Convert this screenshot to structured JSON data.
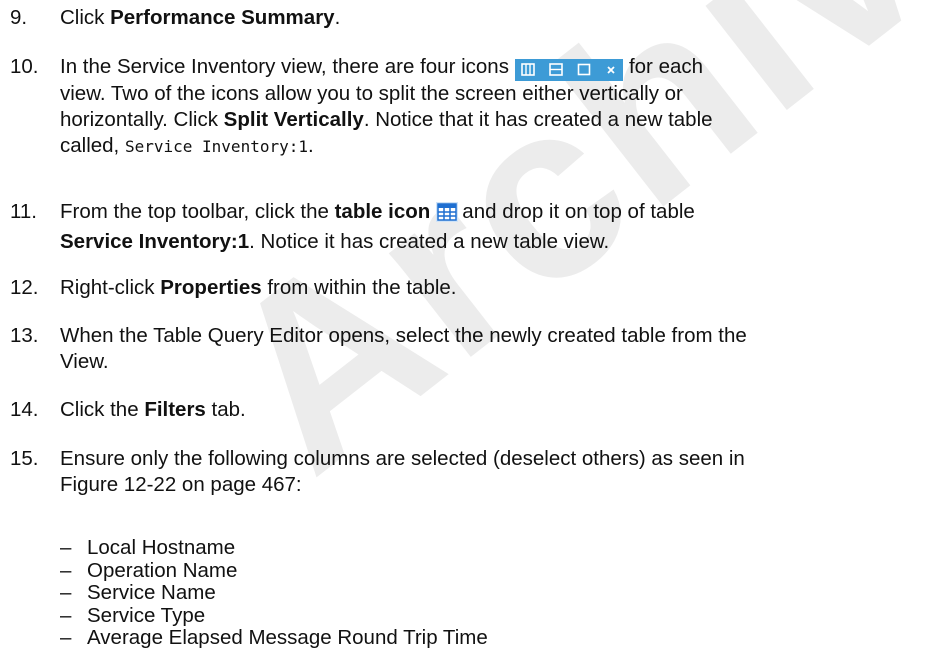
{
  "watermark": "Archived",
  "steps": [
    {
      "num": "9.",
      "parts": [
        "Click ",
        "Performance Summary",
        "."
      ]
    },
    {
      "num": "10.",
      "line1_a": "In the Service Inventory view, there are four icons",
      "line1_b": "for each",
      "line2": "view. Two of the icons allow you to split the screen either vertically or",
      "line3_a": "horizontally. Click ",
      "line3_b": "Split Vertically",
      "line3_c": ". Notice that it has created a new table",
      "line4_a": "called, ",
      "line4_code": "Service Inventory:1",
      "line4_c": "."
    },
    {
      "num": "11.",
      "line1_a": "From the top toolbar, click the ",
      "line1_b": "table icon",
      "line1_c": "and drop it on top of table",
      "line2_b": "Service Inventory:1",
      "line2_c": ". Notice it has created a new table view."
    },
    {
      "num": "12.",
      "a": "Right-click ",
      "b": "Properties",
      "c": " from within the table."
    },
    {
      "num": "13.",
      "line1": "When the Table Query Editor opens, select the newly created table from the",
      "line2": "View."
    },
    {
      "num": "14.",
      "a": "Click the ",
      "b": "Filters",
      "c": " tab."
    },
    {
      "num": "15.",
      "line1": "Ensure only the following columns are selected (deselect others) as seen in",
      "line2": "Figure 12-22 on page 467:"
    }
  ],
  "bullets": [
    "Local Hostname",
    "Operation Name",
    "Service Name",
    "Service Type",
    "Average Elapsed Message Round Trip Time"
  ],
  "icons": {
    "strip": [
      "split-vertical-icon",
      "split-horizontal-icon",
      "maximize-icon",
      "close-icon"
    ],
    "strip_color": "#3d9bd6",
    "table_icon_color": "#1e6fd1"
  }
}
